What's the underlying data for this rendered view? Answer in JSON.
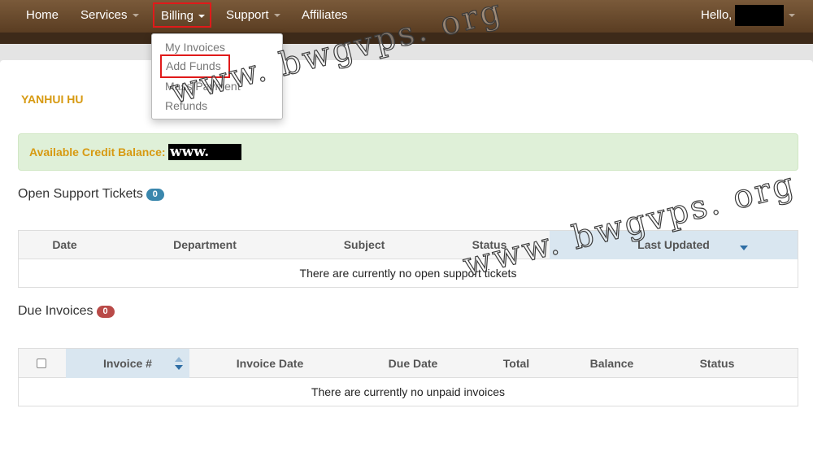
{
  "nav": {
    "home": "Home",
    "services": "Services",
    "billing": "Billing",
    "support": "Support",
    "affiliates": "Affiliates",
    "hello": "Hello,"
  },
  "billing_menu": {
    "items": [
      "My Invoices",
      "Add Funds",
      "Mass Payment",
      "Refunds"
    ]
  },
  "account": {
    "owner_name": "YANHUI HU",
    "credit_label": "Available Credit Balance:",
    "credit_value_mask": "www."
  },
  "tickets": {
    "title": "Open Support Tickets",
    "count": "0",
    "columns": [
      "Date",
      "Department",
      "Subject",
      "Status",
      "Last Updated"
    ],
    "empty_message": "There are currently no open support tickets"
  },
  "invoices": {
    "title": "Due Invoices",
    "count": "0",
    "columns": [
      "Invoice #",
      "Invoice Date",
      "Due Date",
      "Total",
      "Balance",
      "Status"
    ],
    "empty_message": "There are currently no unpaid invoices"
  },
  "watermark": "www. bwgvps. org",
  "colors": {
    "brand_gold": "#d79a12",
    "nav_brown": "#6b4a2e",
    "highlight_red": "#e01a1a",
    "success_bg": "#dff0d8",
    "badge_blue": "#3a87ad",
    "badge_red": "#b94a48"
  }
}
